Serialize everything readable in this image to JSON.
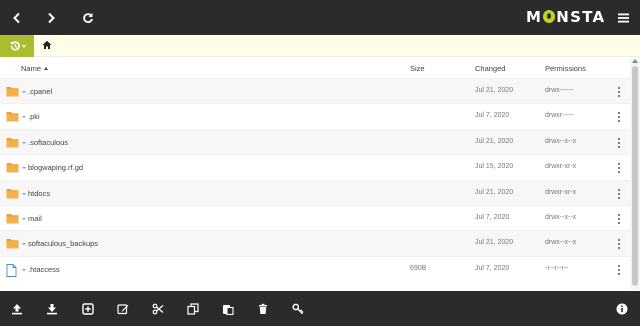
{
  "app": {
    "logo": "MONSTA"
  },
  "toolbar": {
    "back_icon": "chevron-left-icon",
    "forward_icon": "chevron-right-icon",
    "refresh_icon": "refresh-icon",
    "menu_icon": "hamburger-menu-icon"
  },
  "path": {
    "history_icon": "history-icon",
    "home_icon": "home-icon"
  },
  "columns": {
    "name": "Name",
    "size": "Size",
    "changed": "Changed",
    "permissions": "Permissions"
  },
  "files": [
    {
      "type": "folder",
      "name": ".cpanel",
      "size": "",
      "changed": "Jul 21, 2020",
      "permissions": "drwx------"
    },
    {
      "type": "folder",
      "name": ".pki",
      "size": "",
      "changed": "Jul 7, 2020",
      "permissions": "drwxr-----"
    },
    {
      "type": "folder",
      "name": ".softaculous",
      "size": "",
      "changed": "Jul 21, 2020",
      "permissions": "drwx--x--x"
    },
    {
      "type": "folder",
      "name": "blogwaping.rf.gd",
      "size": "",
      "changed": "Jul 15, 2020",
      "permissions": "drwxr-xr-x"
    },
    {
      "type": "folder",
      "name": "htdocs",
      "size": "",
      "changed": "Jul 21, 2020",
      "permissions": "drwxr-xr-x"
    },
    {
      "type": "folder",
      "name": "mail",
      "size": "",
      "changed": "Jul 7, 2020",
      "permissions": "drwx--x--x"
    },
    {
      "type": "folder",
      "name": "softaculous_backups",
      "size": "",
      "changed": "Jul 21, 2020",
      "permissions": "drwx--x--x"
    },
    {
      "type": "file",
      "name": ".htaccess",
      "size": "690B",
      "changed": "Jul 7, 2020",
      "permissions": "-r--r--r--"
    }
  ],
  "bottom_toolbar": [
    "upload-icon",
    "download-icon",
    "new-item-icon",
    "edit-icon",
    "cut-icon",
    "copy-icon",
    "paste-icon",
    "delete-icon",
    "key-icon",
    "info-icon"
  ],
  "colors": {
    "topbar": "#2b2b2b",
    "accent": "#a8be2e",
    "folder": "#f0a030",
    "pathbar": "#fdfde8"
  }
}
